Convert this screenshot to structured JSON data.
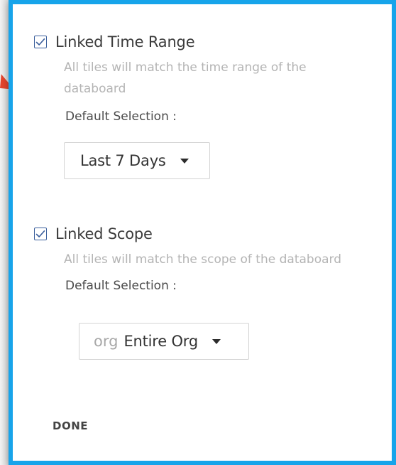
{
  "linked_time_range": {
    "checked": true,
    "label": "Linked Time Range",
    "description": "All tiles will match the time range of the databoard",
    "default_label": "Default Selection :",
    "select": {
      "value": "Last 7 Days",
      "caret_icon": "caret-down-icon"
    }
  },
  "linked_scope": {
    "checked": true,
    "label": "Linked Scope",
    "description": "All tiles will match the scope of the databoard",
    "default_label": "Default Selection :",
    "select": {
      "prefix": "org",
      "value": "Entire Org",
      "caret_icon": "caret-down-icon"
    }
  },
  "footer": {
    "done_label": "DONE"
  },
  "colors": {
    "accent_border": "#17a4ea",
    "checkbox_border": "#3b5f9c",
    "pointer_arrow": "#e5452e"
  }
}
